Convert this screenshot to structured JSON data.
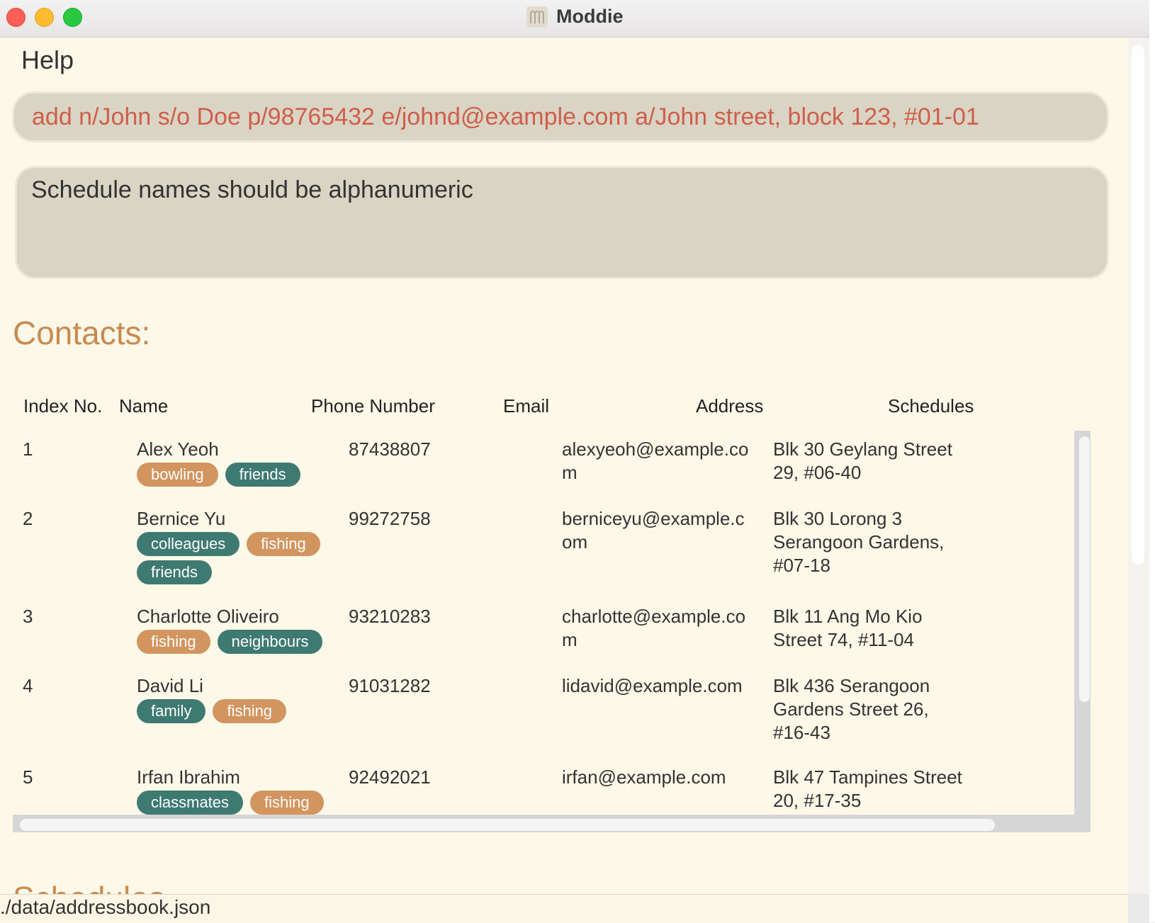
{
  "window": {
    "title": "Moddie",
    "app_icon": "moddie-app-icon"
  },
  "menu": {
    "help_label": "Help"
  },
  "command": {
    "value": "add n/John s/o Doe p/98765432 e/johnd@example.com a/John street, block 123, #01-01"
  },
  "result": {
    "message": "Schedule names should be alphanumeric"
  },
  "contacts": {
    "heading": "Contacts:",
    "columns": {
      "index": "Index No.",
      "name": "Name",
      "phone": "Phone Number",
      "email": "Email",
      "address": "Address",
      "schedules": "Schedules"
    },
    "rows": [
      {
        "index": "1",
        "name": "Alex Yeoh",
        "phone": "87438807",
        "email": "alexyeoh@example.com",
        "address": "Blk 30 Geylang Street 29, #06-40",
        "tags": [
          {
            "label": "bowling",
            "color": "#d2955f"
          },
          {
            "label": "friends",
            "color": "#3f7a72"
          }
        ]
      },
      {
        "index": "2",
        "name": "Bernice Yu",
        "phone": "99272758",
        "email": "berniceyu@example.com",
        "address": "Blk 30 Lorong 3 Serangoon Gardens, #07-18",
        "tags": [
          {
            "label": "colleagues",
            "color": "#3f7a72"
          },
          {
            "label": "fishing",
            "color": "#d2955f"
          },
          {
            "label": "friends",
            "color": "#3f7a72"
          }
        ]
      },
      {
        "index": "3",
        "name": "Charlotte Oliveiro",
        "phone": "93210283",
        "email": "charlotte@example.com",
        "address": "Blk 11 Ang Mo Kio Street 74, #11-04",
        "tags": [
          {
            "label": "fishing",
            "color": "#d2955f"
          },
          {
            "label": "neighbours",
            "color": "#3f7a72"
          }
        ]
      },
      {
        "index": "4",
        "name": "David Li",
        "phone": "91031282",
        "email": "lidavid@example.com",
        "address": "Blk 436 Serangoon Gardens Street 26, #16-43",
        "tags": [
          {
            "label": "family",
            "color": "#3f7a72"
          },
          {
            "label": "fishing",
            "color": "#d2955f"
          }
        ]
      },
      {
        "index": "5",
        "name": "Irfan Ibrahim",
        "phone": "92492021",
        "email": "irfan@example.com",
        "address": "Blk 47 Tampines Street 20, #17-35",
        "tags": [
          {
            "label": "classmates",
            "color": "#3f7a72"
          },
          {
            "label": "fishing",
            "color": "#d2955f"
          }
        ]
      }
    ]
  },
  "schedules": {
    "heading": "Schedules"
  },
  "status": {
    "file_path": "./data/addressbook.json"
  }
}
